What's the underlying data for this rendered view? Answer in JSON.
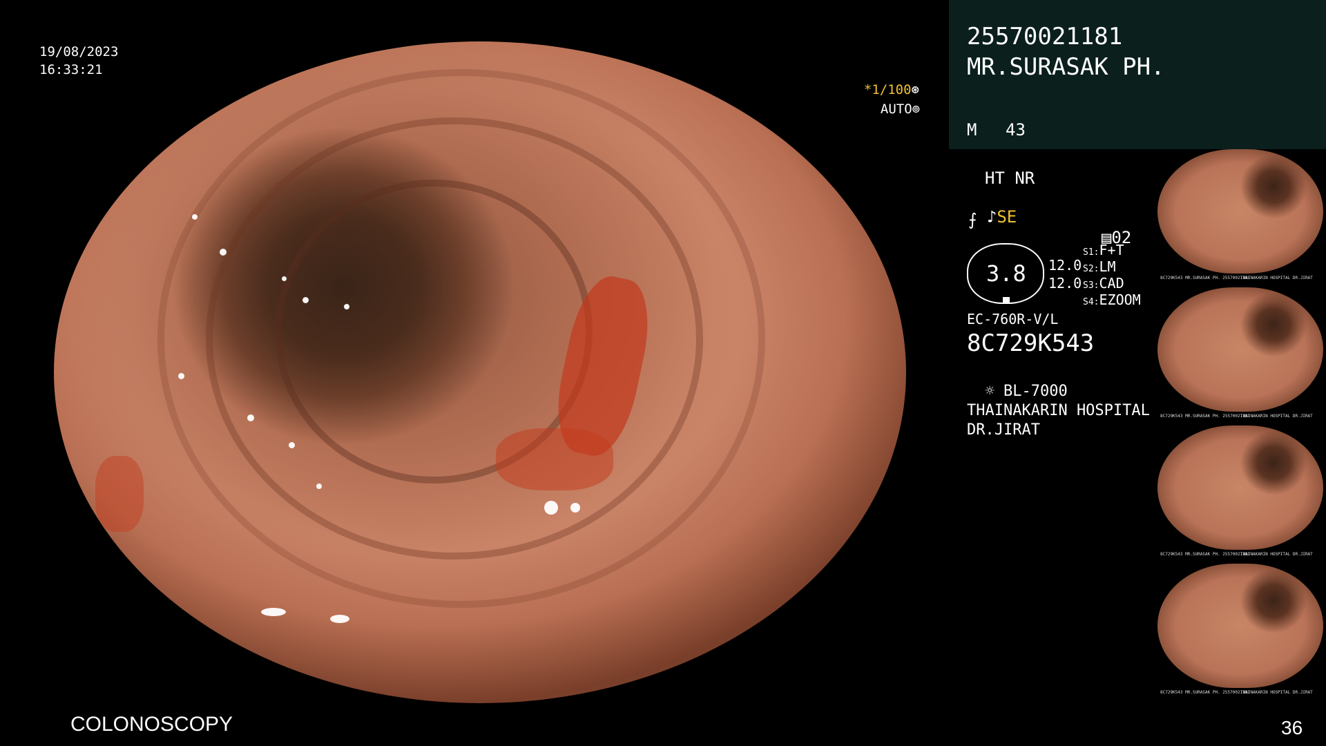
{
  "datetime": {
    "date": "19/08/2023",
    "time": "16:33:21"
  },
  "exposure": {
    "shutter": "*1/100",
    "mode": "AUTO"
  },
  "procedure": "COLONOSCOPY",
  "image_count": "36",
  "patient": {
    "id": "25570021181",
    "name": "MR.SURASAK PH.",
    "sex": "M",
    "age": "43"
  },
  "settings": {
    "ht": "HT NR",
    "se": "SE",
    "page": "02",
    "level": "3.8",
    "val1": "12.0",
    "val2": "12.0",
    "s1_key": "S1:",
    "s1_val": "F+T",
    "s2_key": "S2:",
    "s2_val": "LM",
    "s3_key": "S3:",
    "s3_val": "CAD",
    "s4_key": "S4:",
    "s4_val": "EZOOM"
  },
  "scope": {
    "model": "EC-760R-V/L",
    "serial": "8C729K543",
    "light": "BL-7000"
  },
  "institution": {
    "hospital": "THAINAKARIN HOSPITAL",
    "doctor": "DR.JIRAT"
  },
  "thumb_captions": {
    "left": "8C729K543 MR.SURASAK PH. 25570021181",
    "right": "THAINAKARIN HOSPITAL DR.JIRAT"
  },
  "colors": {
    "header_bg": "#0b1f1d",
    "accent": "#f0c030",
    "text": "#ffffff"
  },
  "icons": [
    "shutter-icon",
    "auto-icon",
    "structure-icon",
    "color-icon",
    "page-icon",
    "lamp-icon"
  ]
}
